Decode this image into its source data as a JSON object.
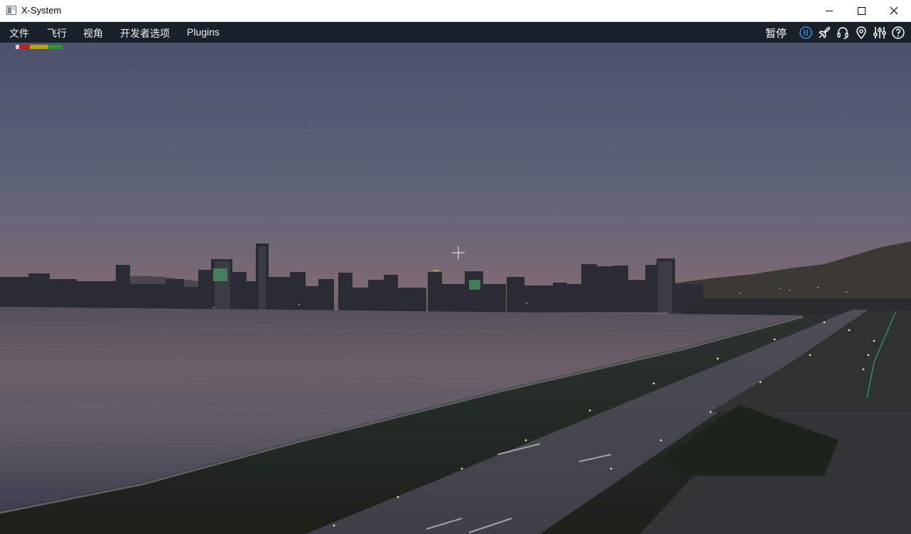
{
  "window": {
    "title": "X-System"
  },
  "menu": {
    "items": [
      "文件",
      "飞行",
      "视角",
      "开发者选项",
      "Plugins"
    ]
  },
  "toolbar": {
    "pause_label": "暂停",
    "icons": [
      "pause-circle-icon",
      "airplane-icon",
      "headset-icon",
      "map-pin-icon",
      "sliders-icon",
      "help-icon"
    ],
    "accent": "#2f8fe6"
  },
  "perf_bar": {
    "segments": [
      {
        "color": "#e8c8d0",
        "fraction": 0.08
      },
      {
        "color": "#c41f1f",
        "fraction": 0.22
      },
      {
        "color": "#b7a21a",
        "fraction": 0.4
      },
      {
        "color": "#27962b",
        "fraction": 0.3
      }
    ]
  }
}
